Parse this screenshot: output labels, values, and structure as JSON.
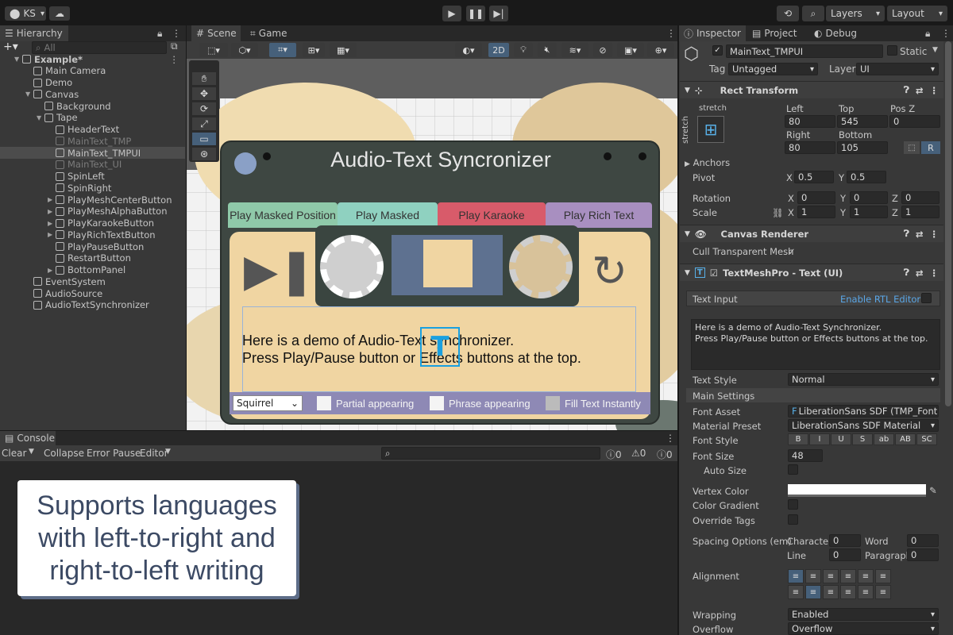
{
  "toolbar": {
    "account": "KS",
    "layers": "Layers",
    "layout": "Layout"
  },
  "hierarchy": {
    "tab": "Hierarchy",
    "search_placeholder": "All",
    "items": [
      {
        "label": "Example*",
        "depth": 0,
        "arrow": "▼",
        "kind": "scene"
      },
      {
        "label": "Main Camera",
        "depth": 1,
        "arrow": ""
      },
      {
        "label": "Demo",
        "depth": 1,
        "arrow": ""
      },
      {
        "label": "Canvas",
        "depth": 1,
        "arrow": "▼"
      },
      {
        "label": "Background",
        "depth": 2,
        "arrow": ""
      },
      {
        "label": "Tape",
        "depth": 2,
        "arrow": "▼"
      },
      {
        "label": "HeaderText",
        "depth": 3,
        "arrow": ""
      },
      {
        "label": "MainText_TMP",
        "depth": 3,
        "arrow": "",
        "dim": true
      },
      {
        "label": "MainText_TMPUI",
        "depth": 3,
        "arrow": "",
        "sel": true
      },
      {
        "label": "MainText_UI",
        "depth": 3,
        "arrow": "",
        "dim": true
      },
      {
        "label": "SpinLeft",
        "depth": 3,
        "arrow": ""
      },
      {
        "label": "SpinRight",
        "depth": 3,
        "arrow": ""
      },
      {
        "label": "PlayMeshCenterButton",
        "depth": 3,
        "arrow": "▶"
      },
      {
        "label": "PlayMeshAlphaButton",
        "depth": 3,
        "arrow": "▶"
      },
      {
        "label": "PlayKaraokeButton",
        "depth": 3,
        "arrow": "▶"
      },
      {
        "label": "PlayRichTextButton",
        "depth": 3,
        "arrow": "▶"
      },
      {
        "label": "PlayPauseButton",
        "depth": 3,
        "arrow": ""
      },
      {
        "label": "RestartButton",
        "depth": 3,
        "arrow": ""
      },
      {
        "label": "BottomPanel",
        "depth": 3,
        "arrow": "▶"
      },
      {
        "label": "EventSystem",
        "depth": 1,
        "arrow": ""
      },
      {
        "label": "AudioSource",
        "depth": 1,
        "arrow": ""
      },
      {
        "label": "AudioTextSynchronizer",
        "depth": 1,
        "arrow": ""
      }
    ]
  },
  "scene": {
    "tabs": [
      "Scene",
      "Game"
    ],
    "mode_2d": "2D",
    "title": "Audio-Text Syncronizer",
    "tape_tabs": [
      "Play Masked Position",
      "Play Masked",
      "Play Karaoke",
      "Play Rich Text"
    ],
    "tape_tab_colors": [
      "#8fc9a9",
      "#8fd1c0",
      "#d85b6a",
      "#a88fc0"
    ],
    "text_line1": "Here is a demo of Audio-Text synchronizer.",
    "text_line2": "Press Play/Pause button or Effects buttons at the top.",
    "voice": "Squirrel",
    "options": [
      "Partial appearing",
      "Phrase appearing",
      "Fill Text Instantly"
    ]
  },
  "console": {
    "tab": "Console",
    "clear": "Clear",
    "collapse": "Collapse",
    "error_pause": "Error Pause",
    "editor": "Editor",
    "count_info": "0",
    "count_warn": "0",
    "count_err": "0"
  },
  "overlay_caption": [
    "Supports languages",
    "with left-to-right and",
    "right-to-left writing"
  ],
  "inspector": {
    "tabs": [
      "Inspector",
      "Project",
      "Debug"
    ],
    "object_name": "MainText_TMPUI",
    "static": "Static",
    "tag_label": "Tag",
    "tag": "Untagged",
    "layer_label": "Layer",
    "layer": "UI",
    "rect": {
      "title": "Rect Transform",
      "anchor": "stretch",
      "left_label": "Left",
      "left": "80",
      "top_label": "Top",
      "top": "545",
      "posz_label": "Pos Z",
      "posz": "0",
      "right_label": "Right",
      "right": "80",
      "bottom_label": "Bottom",
      "bottom": "105",
      "r_btn": "R",
      "anchors": "Anchors",
      "pivot_label": "Pivot",
      "pivot_x": "0.5",
      "pivot_y": "0.5",
      "rotation_label": "Rotation",
      "rot_x": "0",
      "rot_y": "0",
      "rot_z": "0",
      "scale_label": "Scale",
      "sc_x": "1",
      "sc_y": "1",
      "sc_z": "1",
      "x": "X",
      "y": "Y",
      "z": "Z"
    },
    "canvas_renderer": {
      "title": "Canvas Renderer",
      "cull": "Cull Transparent Mesh"
    },
    "tmp": {
      "title": "TextMeshPro - Text (UI)",
      "text_input": "Text Input",
      "rtl": "Enable RTL Editor",
      "text_value_1": "Here is a demo of Audio-Text Synchronizer.",
      "text_value_2": "Press Play/Pause button or Effects buttons at the top.",
      "text_style_label": "Text Style",
      "text_style": "Normal",
      "main_settings": "Main Settings",
      "font_asset_label": "Font Asset",
      "font_asset": "LiberationSans SDF (TMP_Font",
      "material_label": "Material Preset",
      "material": "LiberationSans SDF Material",
      "font_style_label": "Font Style",
      "styles": [
        "B",
        "I",
        "U",
        "S",
        "ab",
        "AB",
        "SC"
      ],
      "font_size_label": "Font Size",
      "font_size": "48",
      "auto_size": "Auto Size",
      "vertex_color": "Vertex Color",
      "color_gradient": "Color Gradient",
      "override_tags": "Override Tags",
      "spacing_label": "Spacing Options (em)",
      "character": "Character",
      "character_v": "0",
      "word": "Word",
      "word_v": "0",
      "line": "Line",
      "line_v": "0",
      "paragraph": "Paragraph",
      "paragraph_v": "0",
      "alignment": "Alignment",
      "wrapping_label": "Wrapping",
      "wrapping": "Enabled",
      "overflow_label": "Overflow",
      "overflow": "Overflow"
    }
  }
}
